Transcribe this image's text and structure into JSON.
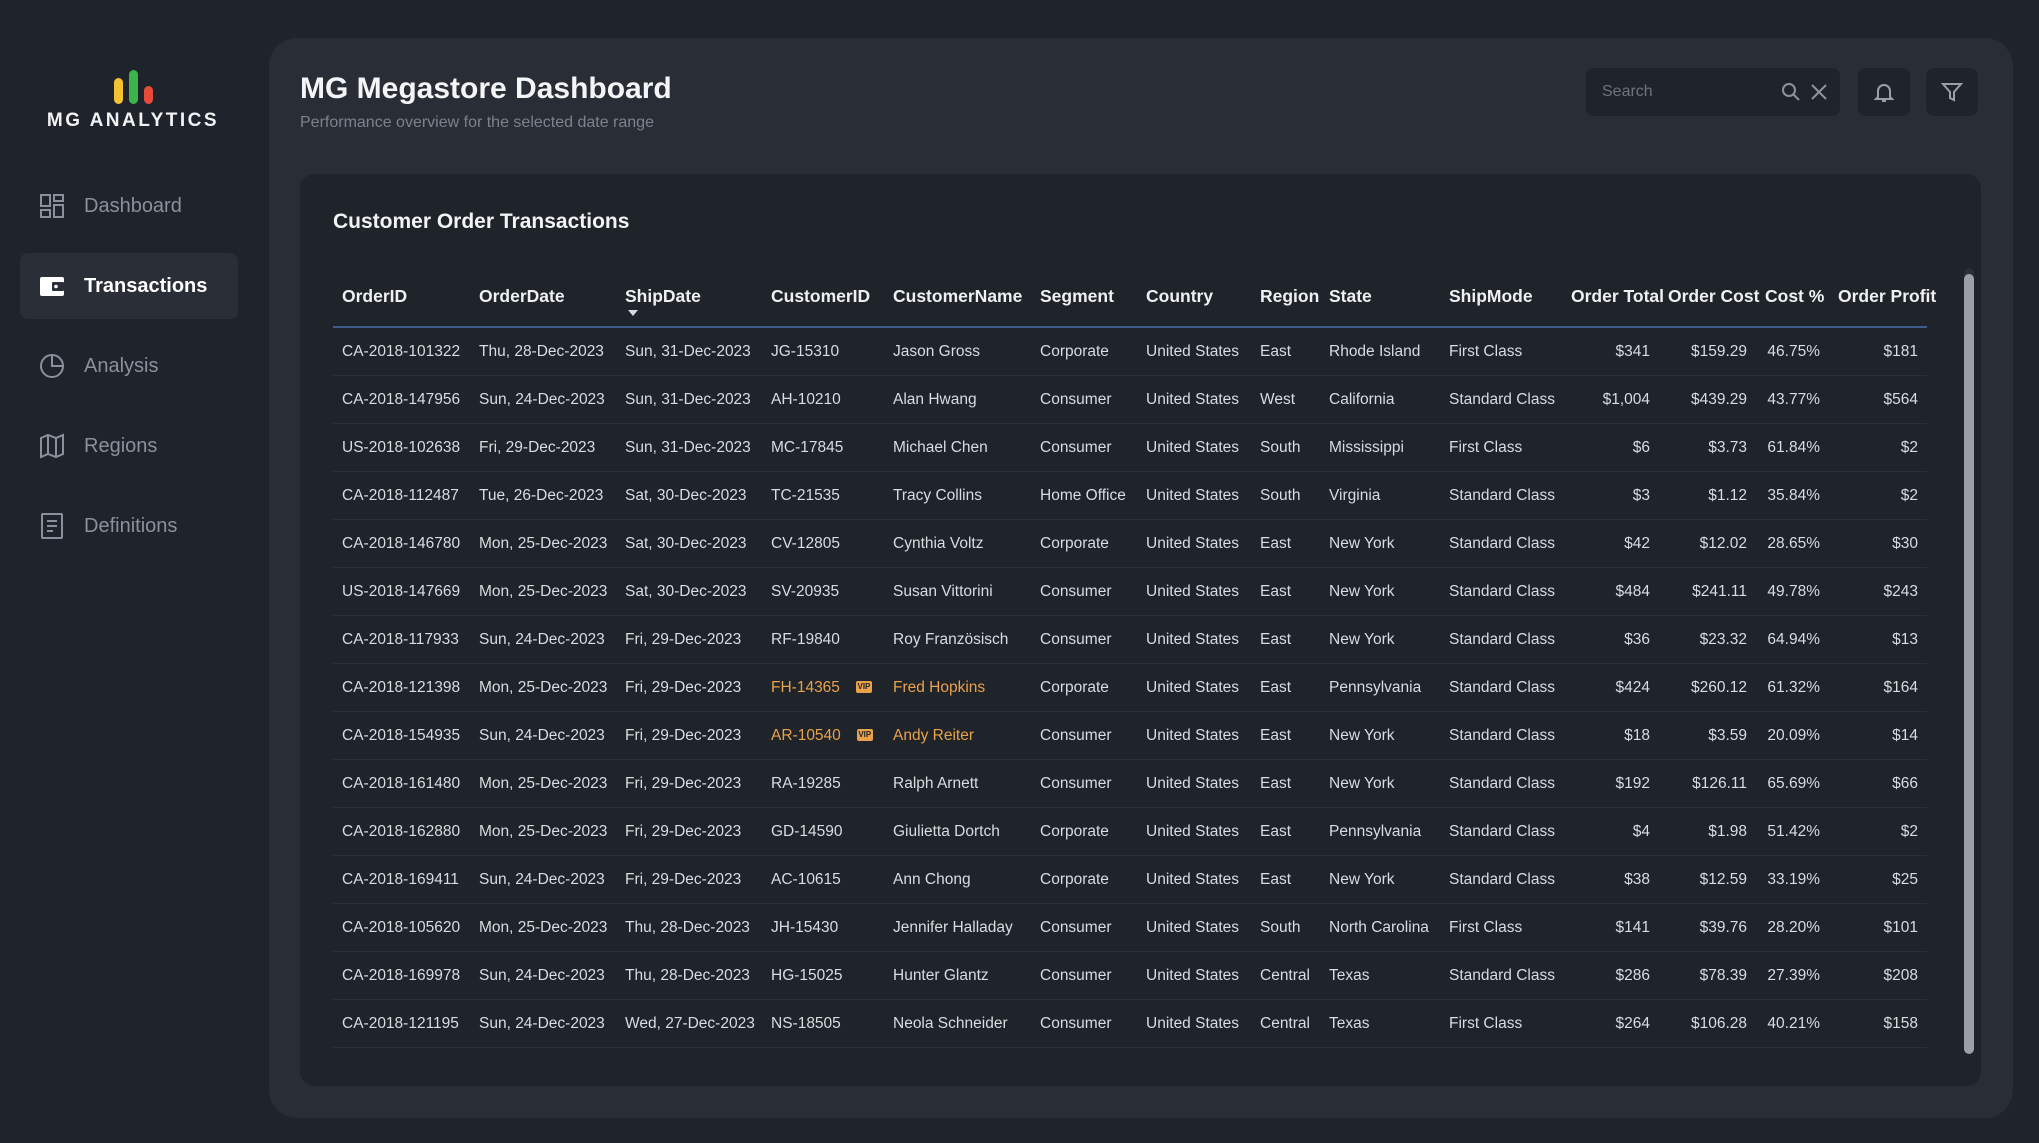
{
  "brand": {
    "name": "MG ANALYTICS",
    "bar_colors": [
      "#f2c230",
      "#3bb54a",
      "#e84a3a"
    ]
  },
  "sidebar": {
    "items": [
      {
        "label": "Dashboard",
        "icon": "grid-icon",
        "active": false
      },
      {
        "label": "Transactions",
        "icon": "wallet-icon",
        "active": true
      },
      {
        "label": "Analysis",
        "icon": "pie-chart-icon",
        "active": false
      },
      {
        "label": "Regions",
        "icon": "map-icon",
        "active": false
      },
      {
        "label": "Definitions",
        "icon": "document-icon",
        "active": false
      }
    ]
  },
  "header": {
    "title": "MG Megastore Dashboard",
    "subtitle": "Performance overview for the selected date range",
    "search_placeholder": "Search"
  },
  "colors": {
    "accent_vip": "#e9a24b",
    "header_underline": "#3f5c8a",
    "panel": "#292d35",
    "background": "#1f232b"
  },
  "table": {
    "title": "Customer Order Transactions",
    "sorted_column": "ShipDate",
    "columns": [
      "OrderID",
      "OrderDate",
      "ShipDate",
      "CustomerID",
      "CustomerName",
      "Segment",
      "Country",
      "Region",
      "State",
      "ShipMode",
      "Order Total",
      "Order Cost",
      "Cost %",
      "Order Profit"
    ],
    "rows": [
      {
        "vip": false,
        "cells": [
          "CA-2018-101322",
          "Thu, 28-Dec-2023",
          "Sun, 31-Dec-2023",
          "JG-15310",
          "Jason Gross",
          "Corporate",
          "United States",
          "East",
          "Rhode Island",
          "First Class",
          "$341",
          "$159.29",
          "46.75%",
          "$181"
        ]
      },
      {
        "vip": false,
        "cells": [
          "CA-2018-147956",
          "Sun, 24-Dec-2023",
          "Sun, 31-Dec-2023",
          "AH-10210",
          "Alan Hwang",
          "Consumer",
          "United States",
          "West",
          "California",
          "Standard Class",
          "$1,004",
          "$439.29",
          "43.77%",
          "$564"
        ]
      },
      {
        "vip": false,
        "cells": [
          "US-2018-102638",
          "Fri, 29-Dec-2023",
          "Sun, 31-Dec-2023",
          "MC-17845",
          "Michael Chen",
          "Consumer",
          "United States",
          "South",
          "Mississippi",
          "First Class",
          "$6",
          "$3.73",
          "61.84%",
          "$2"
        ]
      },
      {
        "vip": false,
        "cells": [
          "CA-2018-112487",
          "Tue, 26-Dec-2023",
          "Sat, 30-Dec-2023",
          "TC-21535",
          "Tracy Collins",
          "Home Office",
          "United States",
          "South",
          "Virginia",
          "Standard Class",
          "$3",
          "$1.12",
          "35.84%",
          "$2"
        ]
      },
      {
        "vip": false,
        "cells": [
          "CA-2018-146780",
          "Mon, 25-Dec-2023",
          "Sat, 30-Dec-2023",
          "CV-12805",
          "Cynthia Voltz",
          "Corporate",
          "United States",
          "East",
          "New York",
          "Standard Class",
          "$42",
          "$12.02",
          "28.65%",
          "$30"
        ]
      },
      {
        "vip": false,
        "cells": [
          "US-2018-147669",
          "Mon, 25-Dec-2023",
          "Sat, 30-Dec-2023",
          "SV-20935",
          "Susan Vittorini",
          "Consumer",
          "United States",
          "East",
          "New York",
          "Standard Class",
          "$484",
          "$241.11",
          "49.78%",
          "$243"
        ]
      },
      {
        "vip": false,
        "cells": [
          "CA-2018-117933",
          "Sun, 24-Dec-2023",
          "Fri, 29-Dec-2023",
          "RF-19840",
          "Roy Französisch",
          "Consumer",
          "United States",
          "East",
          "New York",
          "Standard Class",
          "$36",
          "$23.32",
          "64.94%",
          "$13"
        ]
      },
      {
        "vip": true,
        "cells": [
          "CA-2018-121398",
          "Mon, 25-Dec-2023",
          "Fri, 29-Dec-2023",
          "FH-14365",
          "Fred Hopkins",
          "Corporate",
          "United States",
          "East",
          "Pennsylvania",
          "Standard Class",
          "$424",
          "$260.12",
          "61.32%",
          "$164"
        ]
      },
      {
        "vip": true,
        "cells": [
          "CA-2018-154935",
          "Sun, 24-Dec-2023",
          "Fri, 29-Dec-2023",
          "AR-10540",
          "Andy Reiter",
          "Consumer",
          "United States",
          "East",
          "New York",
          "Standard Class",
          "$18",
          "$3.59",
          "20.09%",
          "$14"
        ]
      },
      {
        "vip": false,
        "cells": [
          "CA-2018-161480",
          "Mon, 25-Dec-2023",
          "Fri, 29-Dec-2023",
          "RA-19285",
          "Ralph Arnett",
          "Consumer",
          "United States",
          "East",
          "New York",
          "Standard Class",
          "$192",
          "$126.11",
          "65.69%",
          "$66"
        ]
      },
      {
        "vip": false,
        "cells": [
          "CA-2018-162880",
          "Mon, 25-Dec-2023",
          "Fri, 29-Dec-2023",
          "GD-14590",
          "Giulietta Dortch",
          "Corporate",
          "United States",
          "East",
          "Pennsylvania",
          "Standard Class",
          "$4",
          "$1.98",
          "51.42%",
          "$2"
        ]
      },
      {
        "vip": false,
        "cells": [
          "CA-2018-169411",
          "Sun, 24-Dec-2023",
          "Fri, 29-Dec-2023",
          "AC-10615",
          "Ann Chong",
          "Corporate",
          "United States",
          "East",
          "New York",
          "Standard Class",
          "$38",
          "$12.59",
          "33.19%",
          "$25"
        ]
      },
      {
        "vip": false,
        "cells": [
          "CA-2018-105620",
          "Mon, 25-Dec-2023",
          "Thu, 28-Dec-2023",
          "JH-15430",
          "Jennifer Halladay",
          "Consumer",
          "United States",
          "South",
          "North Carolina",
          "First Class",
          "$141",
          "$39.76",
          "28.20%",
          "$101"
        ]
      },
      {
        "vip": false,
        "cells": [
          "CA-2018-169978",
          "Sun, 24-Dec-2023",
          "Thu, 28-Dec-2023",
          "HG-15025",
          "Hunter Glantz",
          "Consumer",
          "United States",
          "Central",
          "Texas",
          "Standard Class",
          "$286",
          "$78.39",
          "27.39%",
          "$208"
        ]
      },
      {
        "vip": false,
        "cells": [
          "CA-2018-121195",
          "Sun, 24-Dec-2023",
          "Wed, 27-Dec-2023",
          "NS-18505",
          "Neola Schneider",
          "Consumer",
          "United States",
          "Central",
          "Texas",
          "First Class",
          "$264",
          "$106.28",
          "40.21%",
          "$158"
        ]
      }
    ]
  }
}
